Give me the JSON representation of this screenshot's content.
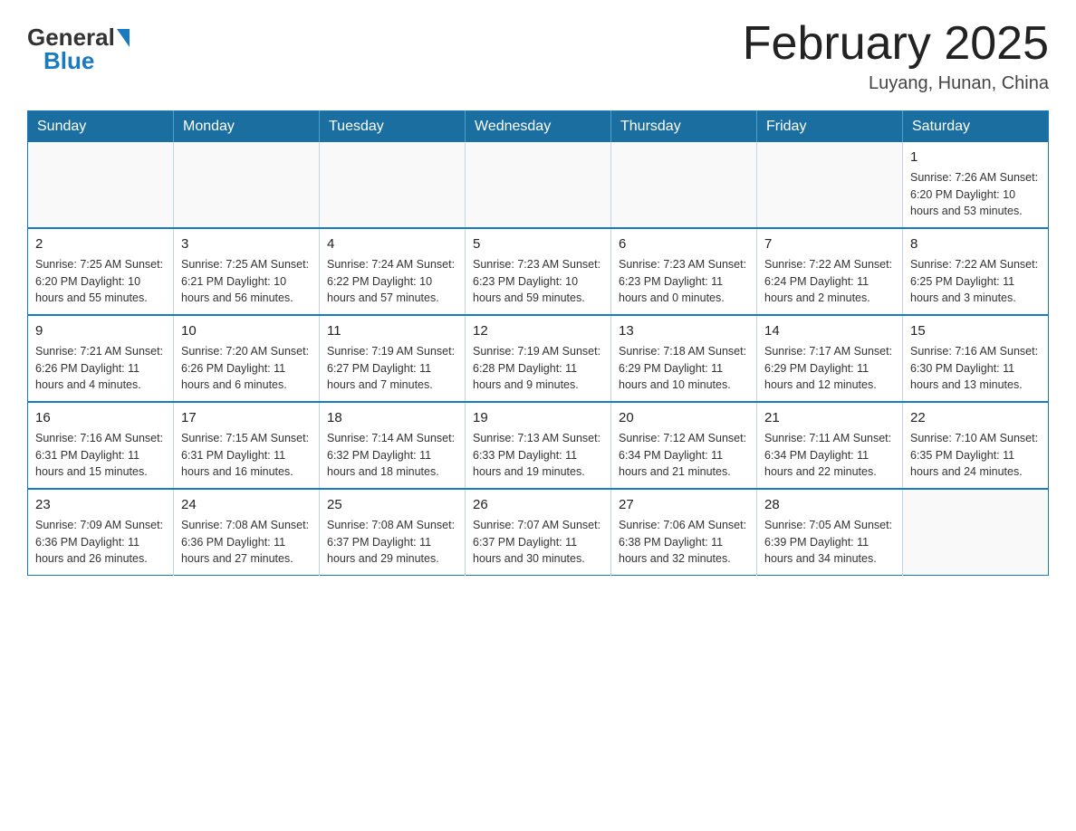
{
  "header": {
    "logo_general": "General",
    "logo_blue": "Blue",
    "month_title": "February 2025",
    "location": "Luyang, Hunan, China"
  },
  "weekdays": [
    "Sunday",
    "Monday",
    "Tuesday",
    "Wednesday",
    "Thursday",
    "Friday",
    "Saturday"
  ],
  "weeks": [
    [
      {
        "day": "",
        "info": ""
      },
      {
        "day": "",
        "info": ""
      },
      {
        "day": "",
        "info": ""
      },
      {
        "day": "",
        "info": ""
      },
      {
        "day": "",
        "info": ""
      },
      {
        "day": "",
        "info": ""
      },
      {
        "day": "1",
        "info": "Sunrise: 7:26 AM\nSunset: 6:20 PM\nDaylight: 10 hours\nand 53 minutes."
      }
    ],
    [
      {
        "day": "2",
        "info": "Sunrise: 7:25 AM\nSunset: 6:20 PM\nDaylight: 10 hours\nand 55 minutes."
      },
      {
        "day": "3",
        "info": "Sunrise: 7:25 AM\nSunset: 6:21 PM\nDaylight: 10 hours\nand 56 minutes."
      },
      {
        "day": "4",
        "info": "Sunrise: 7:24 AM\nSunset: 6:22 PM\nDaylight: 10 hours\nand 57 minutes."
      },
      {
        "day": "5",
        "info": "Sunrise: 7:23 AM\nSunset: 6:23 PM\nDaylight: 10 hours\nand 59 minutes."
      },
      {
        "day": "6",
        "info": "Sunrise: 7:23 AM\nSunset: 6:23 PM\nDaylight: 11 hours\nand 0 minutes."
      },
      {
        "day": "7",
        "info": "Sunrise: 7:22 AM\nSunset: 6:24 PM\nDaylight: 11 hours\nand 2 minutes."
      },
      {
        "day": "8",
        "info": "Sunrise: 7:22 AM\nSunset: 6:25 PM\nDaylight: 11 hours\nand 3 minutes."
      }
    ],
    [
      {
        "day": "9",
        "info": "Sunrise: 7:21 AM\nSunset: 6:26 PM\nDaylight: 11 hours\nand 4 minutes."
      },
      {
        "day": "10",
        "info": "Sunrise: 7:20 AM\nSunset: 6:26 PM\nDaylight: 11 hours\nand 6 minutes."
      },
      {
        "day": "11",
        "info": "Sunrise: 7:19 AM\nSunset: 6:27 PM\nDaylight: 11 hours\nand 7 minutes."
      },
      {
        "day": "12",
        "info": "Sunrise: 7:19 AM\nSunset: 6:28 PM\nDaylight: 11 hours\nand 9 minutes."
      },
      {
        "day": "13",
        "info": "Sunrise: 7:18 AM\nSunset: 6:29 PM\nDaylight: 11 hours\nand 10 minutes."
      },
      {
        "day": "14",
        "info": "Sunrise: 7:17 AM\nSunset: 6:29 PM\nDaylight: 11 hours\nand 12 minutes."
      },
      {
        "day": "15",
        "info": "Sunrise: 7:16 AM\nSunset: 6:30 PM\nDaylight: 11 hours\nand 13 minutes."
      }
    ],
    [
      {
        "day": "16",
        "info": "Sunrise: 7:16 AM\nSunset: 6:31 PM\nDaylight: 11 hours\nand 15 minutes."
      },
      {
        "day": "17",
        "info": "Sunrise: 7:15 AM\nSunset: 6:31 PM\nDaylight: 11 hours\nand 16 minutes."
      },
      {
        "day": "18",
        "info": "Sunrise: 7:14 AM\nSunset: 6:32 PM\nDaylight: 11 hours\nand 18 minutes."
      },
      {
        "day": "19",
        "info": "Sunrise: 7:13 AM\nSunset: 6:33 PM\nDaylight: 11 hours\nand 19 minutes."
      },
      {
        "day": "20",
        "info": "Sunrise: 7:12 AM\nSunset: 6:34 PM\nDaylight: 11 hours\nand 21 minutes."
      },
      {
        "day": "21",
        "info": "Sunrise: 7:11 AM\nSunset: 6:34 PM\nDaylight: 11 hours\nand 22 minutes."
      },
      {
        "day": "22",
        "info": "Sunrise: 7:10 AM\nSunset: 6:35 PM\nDaylight: 11 hours\nand 24 minutes."
      }
    ],
    [
      {
        "day": "23",
        "info": "Sunrise: 7:09 AM\nSunset: 6:36 PM\nDaylight: 11 hours\nand 26 minutes."
      },
      {
        "day": "24",
        "info": "Sunrise: 7:08 AM\nSunset: 6:36 PM\nDaylight: 11 hours\nand 27 minutes."
      },
      {
        "day": "25",
        "info": "Sunrise: 7:08 AM\nSunset: 6:37 PM\nDaylight: 11 hours\nand 29 minutes."
      },
      {
        "day": "26",
        "info": "Sunrise: 7:07 AM\nSunset: 6:37 PM\nDaylight: 11 hours\nand 30 minutes."
      },
      {
        "day": "27",
        "info": "Sunrise: 7:06 AM\nSunset: 6:38 PM\nDaylight: 11 hours\nand 32 minutes."
      },
      {
        "day": "28",
        "info": "Sunrise: 7:05 AM\nSunset: 6:39 PM\nDaylight: 11 hours\nand 34 minutes."
      },
      {
        "day": "",
        "info": ""
      }
    ]
  ]
}
